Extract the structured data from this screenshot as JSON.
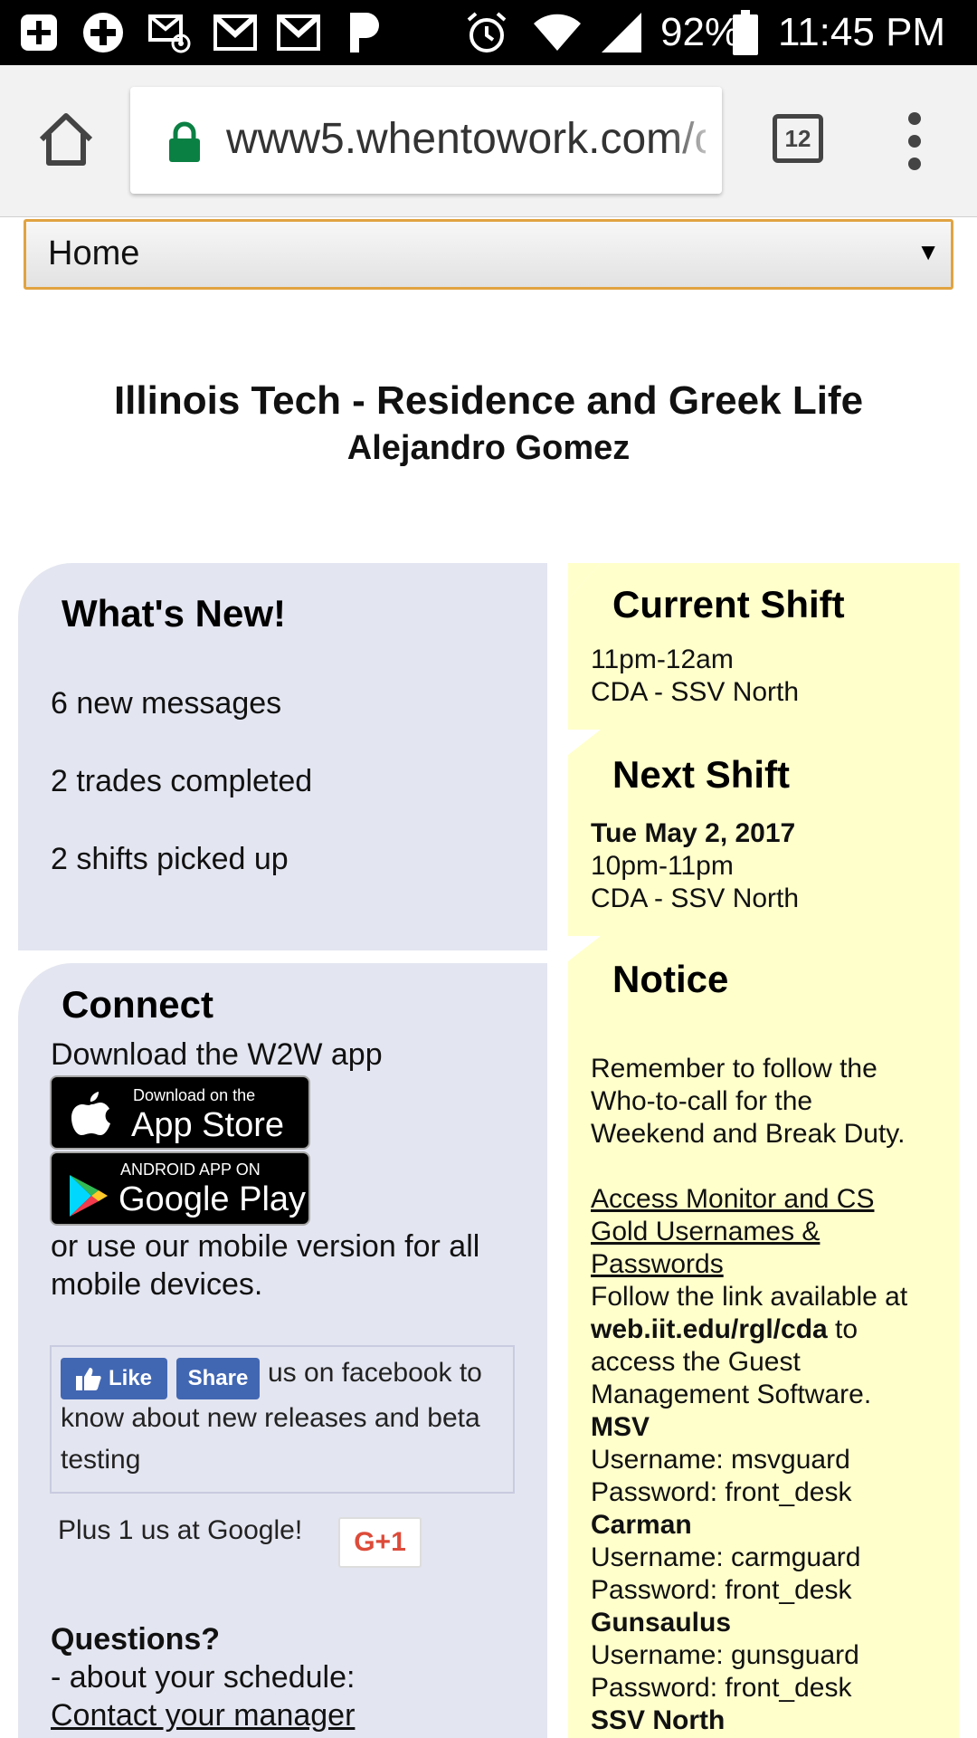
{
  "status_bar": {
    "battery_percent": "92%",
    "time": "11:45 PM",
    "icons": [
      "add-box-icon",
      "plus-circle-icon",
      "mail-at-icon",
      "gmail-icon",
      "gmail-icon",
      "pandora-icon",
      "alarm-icon",
      "wifi-icon",
      "cell-signal-icon",
      "battery-icon"
    ]
  },
  "browser": {
    "url": "www5.whentowork.com/c",
    "tab_count": "12"
  },
  "nav": {
    "selected": "Home"
  },
  "header": {
    "org": "Illinois Tech - Residence and Greek Life",
    "user": "Alejandro Gomez"
  },
  "whats_new": {
    "heading": "What's New!",
    "items": [
      "6 new messages",
      "2 trades completed",
      "2 shifts picked up"
    ]
  },
  "connect": {
    "heading": "Connect",
    "download_text": "Download the W2W app",
    "appstore_small": "Download on the",
    "appstore_big": "App Store",
    "googleplay_small": "ANDROID APP ON",
    "googleplay_big": "Google Play",
    "mobile_line1": "or use our mobile version for all",
    "mobile_line2": "mobile devices.",
    "fb_like": "Like",
    "fb_share": "Share",
    "fb_line1": "us on facebook to",
    "fb_line2": "know about new releases and beta",
    "fb_line3": "testing",
    "plus_text": "Plus 1 us at Google!",
    "gplus_label": "G+1",
    "questions_heading": "Questions?",
    "schedule_q": "- about your schedule:",
    "contact_link": "Contact your manager"
  },
  "current_shift": {
    "heading": "Current Shift",
    "time": "11pm-12am",
    "location": "CDA - SSV North"
  },
  "next_shift": {
    "heading": "Next Shift",
    "date": "Tue May 2, 2017",
    "time": "10pm-11pm",
    "location": "CDA - SSV North"
  },
  "notice": {
    "heading": "Notice",
    "line1": "Remember to follow the",
    "line2": "Who-to-call for the",
    "line3": "Weekend and Break Duty.",
    "link1": "Access Monitor and CS",
    "link2": "Gold Usernames &",
    "link3": "Passwords",
    "follow": "Follow the link available at",
    "url_bold": "web.iit.edu/rgl/cda",
    "url_after": " to",
    "access": "access the Guest",
    "mgmt": "Management Software.",
    "msv": "MSV",
    "msv_user": "Username: msvguard",
    "msv_pass": "Password: front_desk",
    "carman": "Carman",
    "carman_user": "Username: carmguard",
    "carman_pass": "Password: front_desk",
    "guns": "Gunsaulus",
    "guns_user": "Username: gunsguard",
    "guns_pass": "Password: front_desk",
    "ssv": "SSV North"
  }
}
